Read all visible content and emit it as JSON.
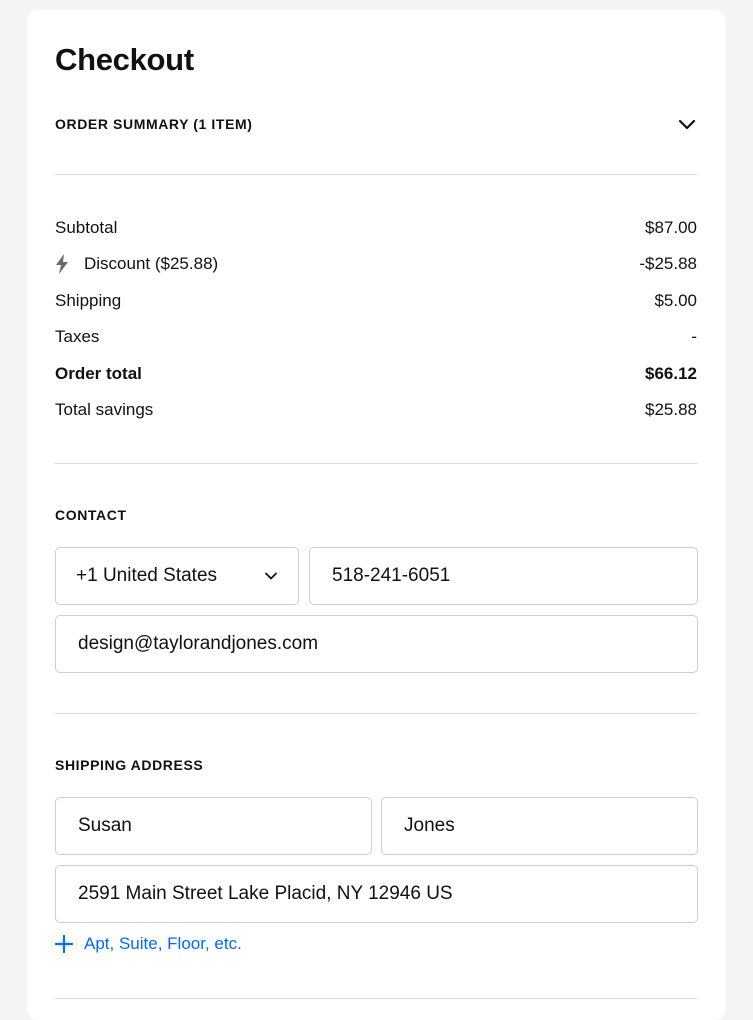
{
  "checkout": {
    "title": "Checkout"
  },
  "summary": {
    "header_label": "ORDER SUMMARY (1 ITEM)",
    "toggle_icon": "chevron-down-icon",
    "rows": {
      "subtotal": {
        "label": "Subtotal",
        "value": "$87.00"
      },
      "discount": {
        "label": "Discount ($25.88)",
        "value": "-$25.88",
        "icon": "lightning-bolt-icon"
      },
      "shipping": {
        "label": "Shipping",
        "value": "$5.00"
      },
      "taxes": {
        "label": "Taxes",
        "value": "-"
      },
      "order_total": {
        "label": "Order total",
        "value": "$66.12"
      },
      "total_savings": {
        "label": "Total savings",
        "value": "$25.88"
      }
    }
  },
  "contact": {
    "label": "CONTACT",
    "country_code": {
      "value": "+1 United States",
      "icon": "chevron-down-icon"
    },
    "phone": {
      "value": "518-241-6051"
    },
    "email": {
      "value": "design@taylorandjones.com"
    }
  },
  "shipping_address": {
    "label": "SHIPPING ADDRESS",
    "first_name": {
      "value": "Susan"
    },
    "last_name": {
      "value": "Jones"
    },
    "address": {
      "value": "2591 Main Street Lake Placid, NY 12946 US"
    },
    "add_line_link": {
      "label": "Apt, Suite, Floor, etc.",
      "icon": "plus-icon"
    }
  },
  "colors": {
    "link": "#006aff",
    "border": "#cfcfcf",
    "divider": "#d9d9d9",
    "background": "#f3f4f6",
    "card": "#ffffff",
    "text": "#111111"
  }
}
